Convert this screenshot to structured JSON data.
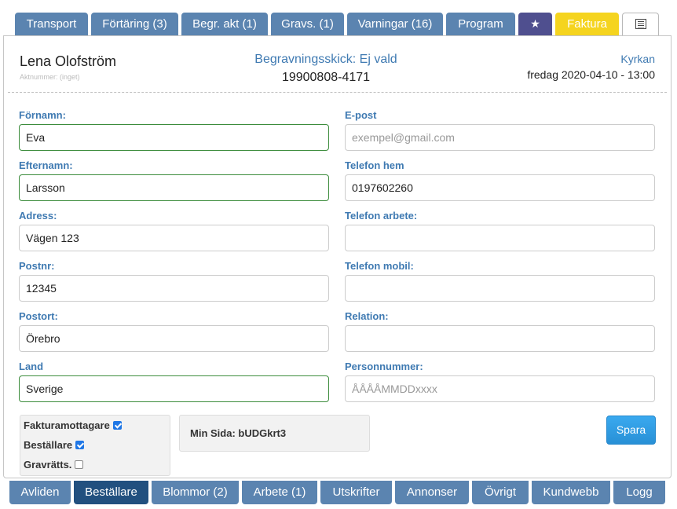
{
  "top_tabs": [
    {
      "label": "Transport"
    },
    {
      "label": "Förtäring (3)"
    },
    {
      "label": "Begr. akt (1)"
    },
    {
      "label": "Gravs. (1)"
    },
    {
      "label": "Varningar (16)"
    },
    {
      "label": "Program"
    },
    {
      "label": "★",
      "icon": "star-icon"
    },
    {
      "label": "Faktura",
      "color": "#f5d41f"
    },
    {
      "label": "",
      "icon": "document-list-icon"
    }
  ],
  "header": {
    "name": "Lena Olofström",
    "account": "Aktnummer: (inget)",
    "ceremony": "Begravningsskick: Ej vald",
    "personal_number": "19900808-4171",
    "location": "Kyrkan",
    "datetime": "fredag 2020-04-10 - 13:00"
  },
  "form": {
    "first_name": {
      "label": "Förnamn:",
      "value": "Eva"
    },
    "last_name": {
      "label": "Efternamn:",
      "value": "Larsson"
    },
    "address": {
      "label": "Adress:",
      "value": "Vägen 123"
    },
    "postal_code": {
      "label": "Postnr:",
      "value": "12345"
    },
    "city": {
      "label": "Postort:",
      "value": "Örebro"
    },
    "country": {
      "label": "Land",
      "value": "Sverige"
    },
    "email": {
      "label": "E-post",
      "value": "",
      "placeholder": "exempel@gmail.com"
    },
    "phone_home": {
      "label": "Telefon hem",
      "value": "0197602260"
    },
    "phone_work": {
      "label": "Telefon arbete:",
      "value": ""
    },
    "phone_mobile": {
      "label": "Telefon mobil:",
      "value": ""
    },
    "relation": {
      "label": "Relation:",
      "value": ""
    },
    "ssn": {
      "label": "Personnummer:",
      "value": "",
      "placeholder": "ÅÅÅÅMMDDxxxx"
    }
  },
  "checkboxes": [
    {
      "label": "Fakturamottagare",
      "checked": true
    },
    {
      "label": "Beställare",
      "checked": true
    },
    {
      "label": "Gravrätts.",
      "checked": false
    }
  ],
  "min_sida": {
    "label": "Min Sida:",
    "code": "bUDGkrt3"
  },
  "save_label": "Spara",
  "bottom_tabs": [
    {
      "label": "Avliden"
    },
    {
      "label": "Beställare",
      "active": true
    },
    {
      "label": "Blommor (2)"
    },
    {
      "label": "Arbete (1)"
    },
    {
      "label": "Utskrifter"
    },
    {
      "label": "Annonser"
    },
    {
      "label": "Övrigt"
    },
    {
      "label": "Kundwebb"
    },
    {
      "label": "Logg"
    }
  ],
  "colors": {
    "tab": "#5b84b0",
    "tab_active": "#22507f",
    "accent": "#3f7ab2",
    "valid_border": "#3c8c3c",
    "save_button": "#2f9ce3"
  }
}
